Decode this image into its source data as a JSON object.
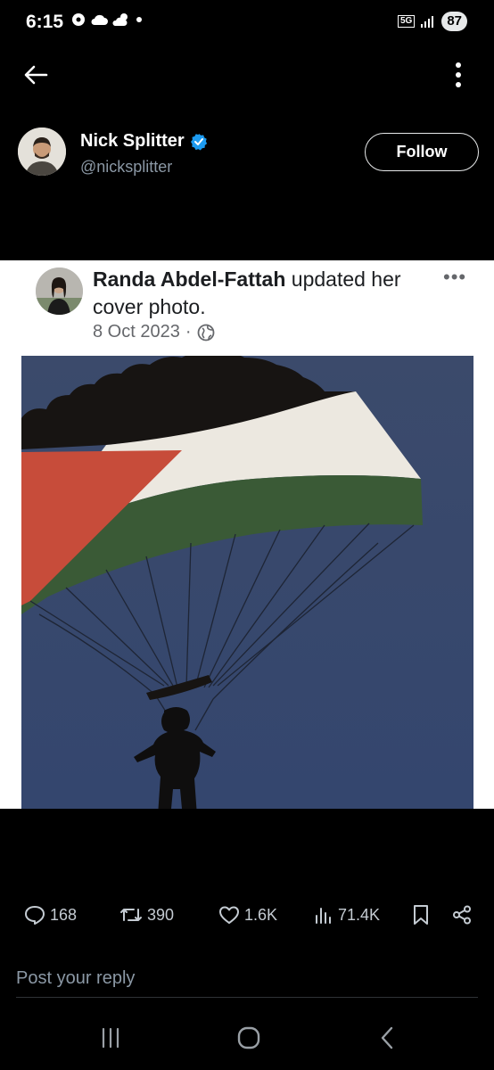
{
  "status_bar": {
    "time": "6:15",
    "network": "5G",
    "battery": "87"
  },
  "post": {
    "author_name": "Nick Splitter",
    "author_handle": "@nicksplitter",
    "follow_label": "Follow",
    "verified_color": "#1d9bf0"
  },
  "embed": {
    "poster_name": "Randa Abdel-Fattah",
    "action_text": " updated her cover photo.",
    "date": "8 Oct 2023",
    "separator": "·",
    "image_subject": "parachute-flag-cover-photo"
  },
  "actions": {
    "replies": "168",
    "reposts": "390",
    "likes": "1.6K",
    "views": "71.4K"
  },
  "reply": {
    "placeholder": "Post your reply"
  },
  "icons": [
    "back-arrow-icon",
    "more-vertical-icon",
    "verified-badge-icon",
    "reply-icon",
    "repost-icon",
    "like-icon",
    "views-icon",
    "bookmark-icon",
    "share-icon",
    "globe-icon",
    "recents-icon",
    "home-icon",
    "back-icon"
  ]
}
